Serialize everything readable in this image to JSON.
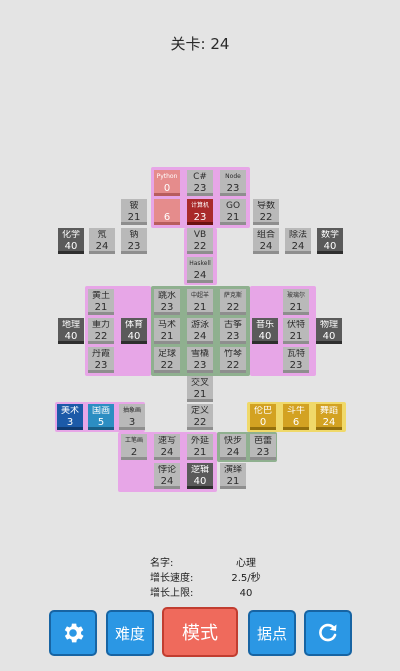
{
  "header": {
    "level_text": "关卡: 24"
  },
  "tiles": [
    {
      "name": "tile-python",
      "label": "Python",
      "value": "0",
      "style": "pink"
    },
    {
      "name": "tile-csharp",
      "label": "C#",
      "value": "23",
      "style": "light"
    },
    {
      "name": "tile-node",
      "label": "Node",
      "value": "23",
      "style": "light"
    },
    {
      "name": "tile-ganglia",
      "label": "",
      "value": "6",
      "style": "pink"
    },
    {
      "name": "tile-bo",
      "label": "铍",
      "value": "21",
      "style": "light"
    },
    {
      "name": "tile-computer",
      "label": "计算机",
      "value": "23",
      "style": "red"
    },
    {
      "name": "tile-go",
      "label": "GO",
      "value": "21",
      "style": "light"
    },
    {
      "name": "tile-conductivity",
      "label": "导数",
      "value": "22",
      "style": "light"
    },
    {
      "name": "tile-chemistry",
      "label": "化学",
      "value": "40",
      "style": "dark"
    },
    {
      "name": "tile-nitrogen",
      "label": "氖",
      "value": "24",
      "style": "light"
    },
    {
      "name": "tile-sodium",
      "label": "钠",
      "value": "23",
      "style": "light"
    },
    {
      "name": "tile-vb",
      "label": "VB",
      "value": "22",
      "style": "light"
    },
    {
      "name": "tile-combination",
      "label": "组合",
      "value": "24",
      "style": "light"
    },
    {
      "name": "tile-division",
      "label": "除法",
      "value": "24",
      "style": "light"
    },
    {
      "name": "tile-math",
      "label": "数学",
      "value": "40",
      "style": "dark"
    },
    {
      "name": "tile-haskell",
      "label": "Haskell",
      "value": "24",
      "style": "light"
    },
    {
      "name": "tile-yellow-soil",
      "label": "黄土",
      "value": "21",
      "style": "light"
    },
    {
      "name": "tile-jumping",
      "label": "跳水",
      "value": "23",
      "style": "light"
    },
    {
      "name": "tile-china-cup",
      "label": "中超羊",
      "value": "21",
      "style": "light"
    },
    {
      "name": "tile-lute",
      "label": "萨克斯",
      "value": "22",
      "style": "light"
    },
    {
      "name": "tile-electromagnetic",
      "label": "玻璃尔",
      "value": "21",
      "style": "light"
    },
    {
      "name": "tile-geography",
      "label": "地理",
      "value": "40",
      "style": "dark"
    },
    {
      "name": "tile-gravity",
      "label": "重力",
      "value": "22",
      "style": "light"
    },
    {
      "name": "tile-sports",
      "label": "体育",
      "value": "40",
      "style": "dark"
    },
    {
      "name": "tile-horse",
      "label": "马术",
      "value": "21",
      "style": "light"
    },
    {
      "name": "tile-swimming",
      "label": "游泳",
      "value": "24",
      "style": "light"
    },
    {
      "name": "tile-guzheng",
      "label": "古筝",
      "value": "23",
      "style": "light"
    },
    {
      "name": "tile-music",
      "label": "音乐",
      "value": "40",
      "style": "dark"
    },
    {
      "name": "tile-volt",
      "label": "伏特",
      "value": "21",
      "style": "light"
    },
    {
      "name": "tile-physics",
      "label": "物理",
      "value": "40",
      "style": "dark"
    },
    {
      "name": "tile-danxia",
      "label": "丹霞",
      "value": "23",
      "style": "light"
    },
    {
      "name": "tile-football",
      "label": "足球",
      "value": "22",
      "style": "light"
    },
    {
      "name": "tile-snooker",
      "label": "雪橇",
      "value": "23",
      "style": "light"
    },
    {
      "name": "tile-flute",
      "label": "竹琴",
      "value": "22",
      "style": "light"
    },
    {
      "name": "tile-watt",
      "label": "瓦特",
      "value": "23",
      "style": "light"
    },
    {
      "name": "tile-intersect",
      "label": "交叉",
      "value": "21",
      "style": "light"
    },
    {
      "name": "tile-art",
      "label": "美术",
      "value": "3",
      "style": "blue"
    },
    {
      "name": "tile-painting",
      "label": "国画",
      "value": "5",
      "style": "cyan"
    },
    {
      "name": "tile-oil",
      "label": "抽象画",
      "value": "3",
      "style": "light"
    },
    {
      "name": "tile-definition",
      "label": "定义",
      "value": "22",
      "style": "light"
    },
    {
      "name": "tile-ethics",
      "label": "伦巴",
      "value": "0",
      "style": "gold"
    },
    {
      "name": "tile-dance",
      "label": "斗牛",
      "value": "6",
      "style": "gold"
    },
    {
      "name": "tile-dancing",
      "label": "舞蹈",
      "value": "24",
      "style": "gold"
    },
    {
      "name": "tile-craft",
      "label": "工笔画",
      "value": "2",
      "style": "light"
    },
    {
      "name": "tile-sketch",
      "label": "速写",
      "value": "24",
      "style": "light"
    },
    {
      "name": "tile-extension",
      "label": "外延",
      "value": "21",
      "style": "light"
    },
    {
      "name": "tile-fast-step",
      "label": "快步",
      "value": "24",
      "style": "light"
    },
    {
      "name": "tile-ballet",
      "label": "芭蕾",
      "value": "23",
      "style": "light"
    },
    {
      "name": "tile-paradox",
      "label": "悖论",
      "value": "24",
      "style": "light"
    },
    {
      "name": "tile-logic",
      "label": "逻辑",
      "value": "40",
      "style": "dark"
    },
    {
      "name": "tile-deduction",
      "label": "演绎",
      "value": "21",
      "style": "light"
    }
  ],
  "info": {
    "name_key": "名字:",
    "name_val": "心理",
    "speed_key": "增长速度:",
    "speed_val": "2.5/秒",
    "limit_key": "增长上限:",
    "limit_val": "40"
  },
  "buttons": {
    "settings_icon": "gear-icon",
    "difficulty": "难度",
    "mode": "模式",
    "base": "据点",
    "restart_icon": "refresh-icon"
  },
  "colors": {
    "button_blue": "#2b97e4",
    "button_red": "#ef6a5c",
    "group_pink": "#e7a6e7",
    "group_green": "#8fb08f",
    "group_yellow": "#f0d96a"
  }
}
